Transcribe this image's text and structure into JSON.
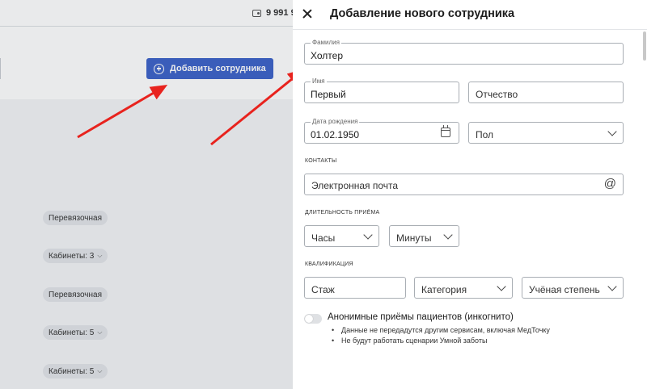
{
  "background": {
    "balance": "9 991 9",
    "add_button_label": "Добавить сотрудника",
    "chips": [
      "Перевязочная",
      "Кабинеты: 3",
      "Перевязочная",
      "Кабинеты: 5",
      "Кабинеты: 5"
    ],
    "arrow_color": "#e8231e"
  },
  "drawer": {
    "title": "Добавление нового сотрудника",
    "lastname": {
      "label": "Фамилия",
      "value": "Холтер"
    },
    "firstname": {
      "label": "Имя",
      "value": "Первый"
    },
    "middlename": {
      "placeholder": "Отчество"
    },
    "birthdate": {
      "label": "Дата рождения",
      "value": "01.02.1950"
    },
    "gender": {
      "placeholder": "Пол"
    },
    "contacts": {
      "section": "контакты",
      "email_placeholder": "Электронная почта"
    },
    "duration": {
      "section": "длительность приёма",
      "hours": "Часы",
      "minutes": "Минуты"
    },
    "qualification": {
      "section": "квалификация",
      "experience": "Стаж",
      "category": "Категория",
      "degree": "Учёная степень"
    },
    "anonymous": {
      "label": "Анонимные приёмы пациентов (инкогнито)",
      "notes": [
        "Данные не передадутся другим сервисам, включая МедТочку",
        "Не будут работать сценарии Умной заботы"
      ]
    }
  },
  "colors": {
    "primary": "#3d63c9",
    "border": "#a9aeb4"
  }
}
